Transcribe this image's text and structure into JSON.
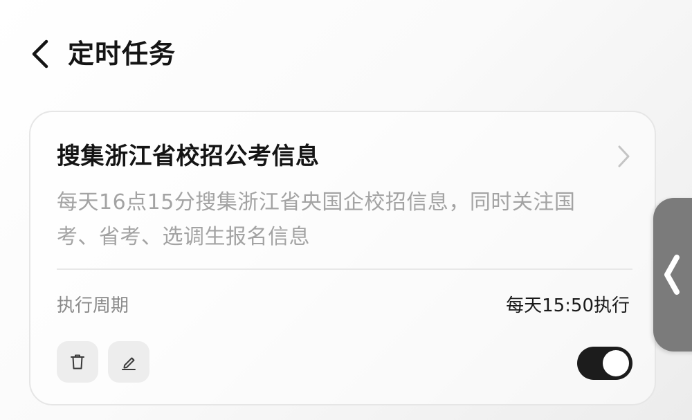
{
  "header": {
    "back_icon": "chevron-left-icon",
    "title": "定时任务"
  },
  "task": {
    "title": "搜集浙江省校招公考信息",
    "arrow_icon": "chevron-right-icon",
    "description": "每天16点15分搜集浙江省央国企校招信息，同时关注国考、省考、选调生报名信息",
    "period_label": "执行周期",
    "period_value": "每天15:50执行",
    "delete_icon": "trash-icon",
    "edit_icon": "pencil-icon",
    "enabled": true
  },
  "side_handle": {
    "icon": "chevron-left-icon"
  },
  "colors": {
    "title": "#141414",
    "muted": "#a3a3a3",
    "toggle_on": "#1c1c1c",
    "side_handle": "#7b7b7b"
  }
}
